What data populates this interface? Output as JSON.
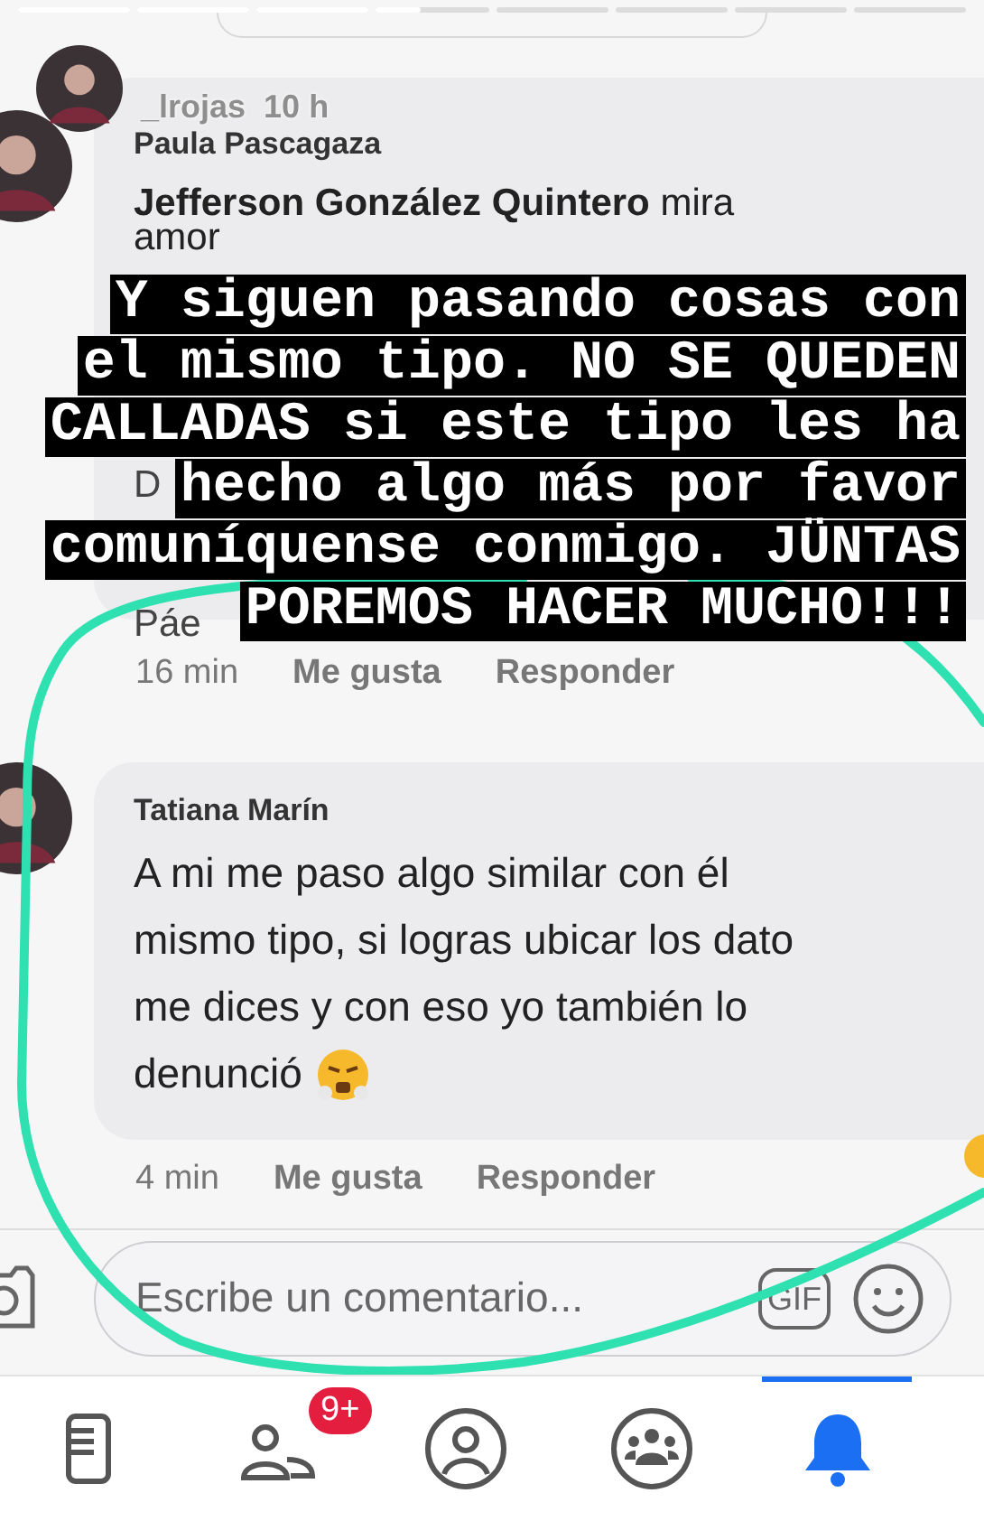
{
  "story": {
    "segments": [
      {
        "level": 1
      },
      {
        "level": 1
      },
      {
        "level": 1
      },
      {
        "level": 0.4
      },
      {
        "level": 0
      },
      {
        "level": 0
      },
      {
        "level": 0
      },
      {
        "level": 0
      }
    ],
    "author": "_lrojas",
    "time": "10 h",
    "caption_lines": [
      "Y siguen pasando cosas con",
      "el mismo tipo. NO SE QUEDEN",
      "CALLADAS si este tipo les ha",
      "hecho algo más por favor",
      "comuníquense conmigo. JÜNTAS",
      "POREMOS HACER MUCHO!!!"
    ]
  },
  "comments": [
    {
      "author": "Paula Pascagaza",
      "mention": "Jefferson González Quintero",
      "text": "mira",
      "continuation": "amor",
      "time": "16 min",
      "like": "Me gusta",
      "reply": "Responder",
      "hidden_fragments": [
        "D",
        "Páe"
      ]
    },
    {
      "author": "Tatiana Marín",
      "text_lines": [
        "A mi me paso algo similar con él",
        "mismo tipo, si logras ubicar los dato",
        "me dices y con eso yo también lo",
        "denunció"
      ],
      "time": "4 min",
      "like": "Me gusta",
      "reply": "Responder"
    }
  ],
  "composer": {
    "placeholder": "Escribe un comentario...",
    "gif": "GIF"
  },
  "nav": [
    {
      "kind": "feed",
      "selected": false
    },
    {
      "kind": "friends",
      "selected": false,
      "badge": "9+"
    },
    {
      "kind": "profile",
      "selected": false
    },
    {
      "kind": "groups",
      "selected": false
    },
    {
      "kind": "bell",
      "selected": true
    }
  ]
}
